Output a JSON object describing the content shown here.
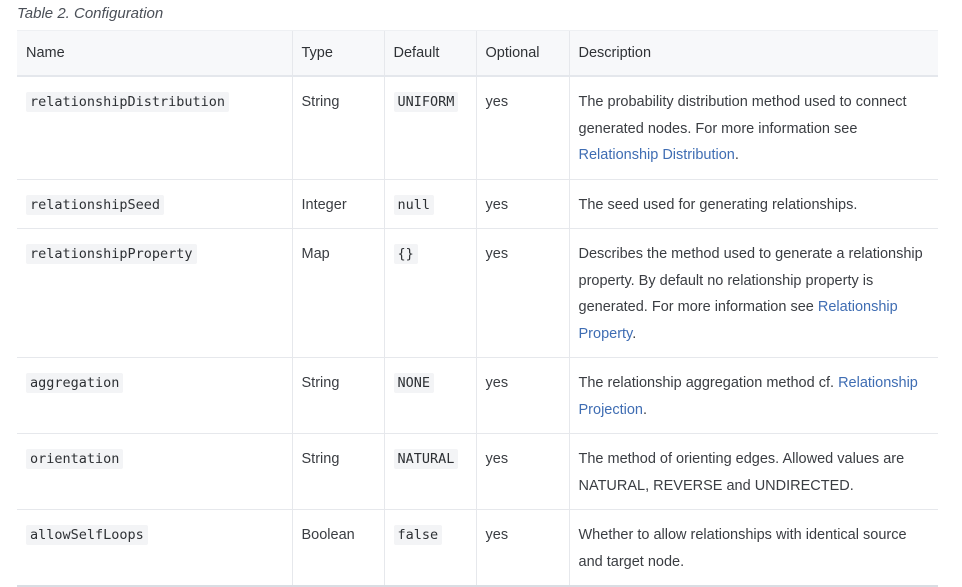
{
  "caption": "Table 2. Configuration",
  "headers": {
    "name": "Name",
    "type": "Type",
    "default": "Default",
    "optional": "Optional",
    "description": "Description"
  },
  "rows": [
    {
      "name": "relationshipDistribution",
      "type": "String",
      "default": "UNIFORM",
      "optional": "yes",
      "desc_text": "The probability distribution method used to connect generated nodes. For more information see ",
      "desc_link": "Relationship Distribution",
      "desc_after": "."
    },
    {
      "name": "relationshipSeed",
      "type": "Integer",
      "default": "null",
      "optional": "yes",
      "desc_text": "The seed used for generating relationships.",
      "desc_link": "",
      "desc_after": ""
    },
    {
      "name": "relationshipProperty",
      "type": "Map",
      "default": "{}",
      "optional": "yes",
      "desc_text": "Describes the method used to generate a relationship property. By default no relationship property is generated. For more information see ",
      "desc_link": "Relationship Property",
      "desc_after": "."
    },
    {
      "name": "aggregation",
      "type": "String",
      "default": "NONE",
      "optional": "yes",
      "desc_text": "The relationship aggregation method cf. ",
      "desc_link": "Relationship Projection",
      "desc_after": "."
    },
    {
      "name": "orientation",
      "type": "String",
      "default": "NATURAL",
      "optional": "yes",
      "desc_text": "The method of orienting edges. Allowed values are NATURAL, REVERSE and UNDIRECTED.",
      "desc_link": "",
      "desc_after": ""
    },
    {
      "name": "allowSelfLoops",
      "type": "Boolean",
      "default": "false",
      "optional": "yes",
      "desc_text": "Whether to allow relationships with identical source and target node.",
      "desc_link": "",
      "desc_after": ""
    }
  ]
}
